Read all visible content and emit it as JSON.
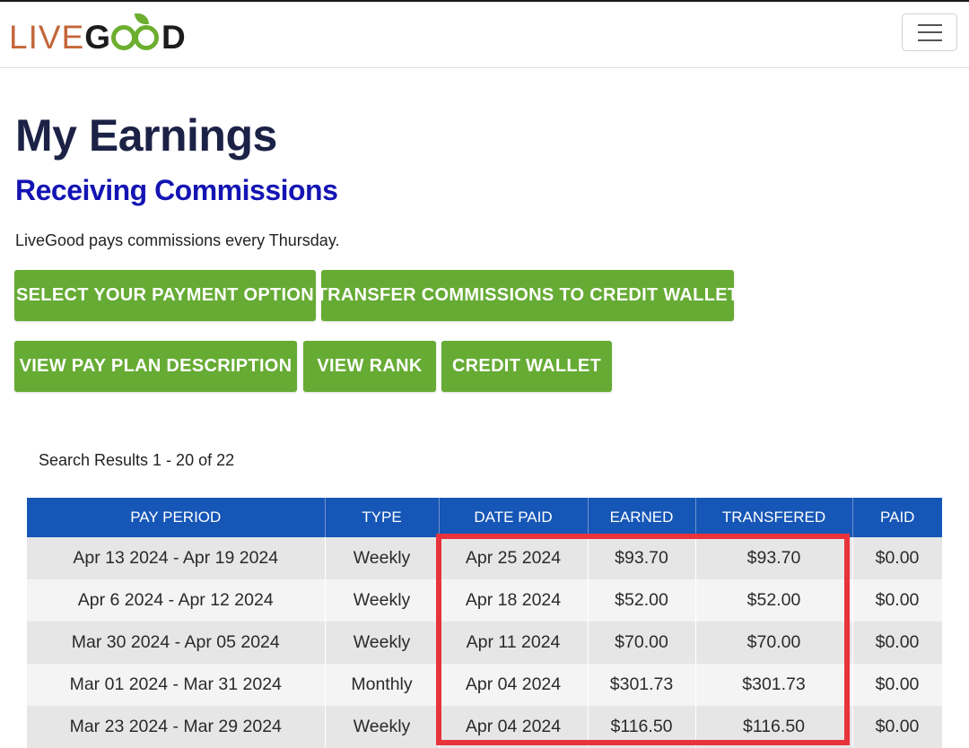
{
  "header": {
    "logo_live": "LIVE",
    "logo_g": "G",
    "logo_d": "D",
    "menu_icon": "hamburger-menu-icon"
  },
  "main": {
    "title": "My Earnings",
    "subtitle": "Receiving Commissions",
    "intro": "LiveGood pays commissions every Thursday.",
    "buttons": [
      "SELECT YOUR PAYMENT OPTION",
      "TRANSFER COMMISSIONS TO CREDIT WALLET",
      "VIEW PAY PLAN DESCRIPTION",
      "VIEW RANK",
      "CREDIT WALLET"
    ],
    "results_text": "Search Results 1 - 20 of 22"
  },
  "table": {
    "columns": [
      "PAY PERIOD",
      "TYPE",
      "DATE PAID",
      "EARNED",
      "TRANSFERED",
      "PAID"
    ],
    "rows": [
      [
        "Apr 13 2024 - Apr 19 2024",
        "Weekly",
        "Apr 25 2024",
        "$93.70",
        "$93.70",
        "$0.00"
      ],
      [
        "Apr 6 2024 - Apr 12 2024",
        "Weekly",
        "Apr 18 2024",
        "$52.00",
        "$52.00",
        "$0.00"
      ],
      [
        "Mar 30 2024 - Apr 05 2024",
        "Weekly",
        "Apr 11 2024",
        "$70.00",
        "$70.00",
        "$0.00"
      ],
      [
        "Mar 01 2024 - Mar 31 2024",
        "Monthly",
        "Apr 04 2024",
        "$301.73",
        "$301.73",
        "$0.00"
      ],
      [
        "Mar 23 2024 - Mar 29 2024",
        "Weekly",
        "Apr 04 2024",
        "$116.50",
        "$116.50",
        "$0.00"
      ]
    ]
  },
  "colors": {
    "brand_green": "#66ab34",
    "header_blue": "#1656b6",
    "highlight_red": "#e8333a",
    "title_navy": "#1c2246",
    "subtitle_blue": "#1414b4"
  }
}
